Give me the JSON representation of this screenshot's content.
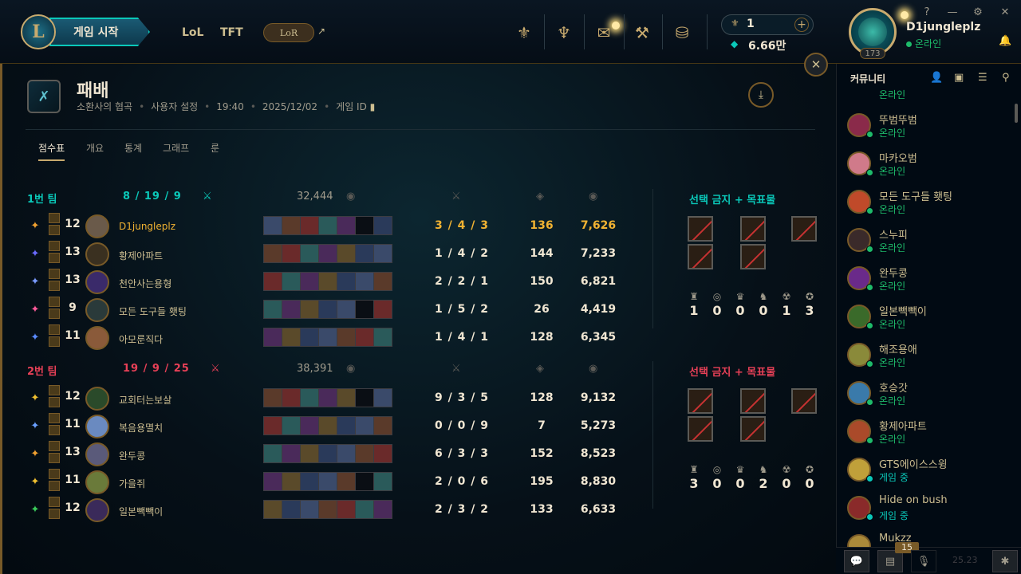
{
  "topbar": {
    "play_label": "게임 시작",
    "logo_glyph": "L",
    "nav_lol": "LoL",
    "nav_tft": "TFT",
    "nav_lor": "LoR",
    "external_glyph": "↗",
    "icons": {
      "ranked": "⚜",
      "collection": "♆",
      "loot": "✉",
      "crafting": "⚒",
      "store": "⛁"
    },
    "currency_tokens": "1",
    "currency_be": "6.66만",
    "plus_glyph": "+",
    "token_glyph": "⚜",
    "be_glyph": "◆",
    "username": "D1jungleplz",
    "status": "온라인",
    "level": "173",
    "window_help": "?",
    "window_min": "—",
    "window_settings": "⚙",
    "window_close": "✕",
    "bell_glyph": "🔔"
  },
  "match": {
    "result": "패배",
    "map": "소환사의 협곡",
    "mode": "사용자 설정",
    "duration": "19:40",
    "date": "2025/12/02",
    "game_id_label": "게임 ID",
    "close_glyph": "✕",
    "download_glyph": "⤓",
    "result_glyph": "✗",
    "tabs": [
      "점수표",
      "개요",
      "통계",
      "그래프",
      "룬"
    ]
  },
  "column_icons": {
    "kda": "⚔",
    "cs": "◈",
    "gold": "◉",
    "kill_participation": "⚔"
  },
  "teams": [
    {
      "name": "1번 팀",
      "kda": "8 / 19 / 9",
      "gold": "32,444",
      "color": "#0ac8b9",
      "bans_title": "선택 금지 + 목표물",
      "bans": [
        "ban",
        "ban",
        "ban",
        "ban",
        "ban"
      ],
      "objectives": [
        "1",
        "0",
        "0",
        "0",
        "1",
        "3"
      ],
      "players": [
        {
          "name": "D1jungleplz",
          "level": "12",
          "kda": "3 / 4 / 3",
          "cs": "136",
          "gold": "7,626",
          "champ_color": "#6a5a4a",
          "sum_color": "#f0a030",
          "me": true
        },
        {
          "name": "황제아파트",
          "level": "13",
          "kda": "1 / 4 / 2",
          "cs": "144",
          "gold": "7,233",
          "champ_color": "#3a3020",
          "sum_color": "#6a6aff",
          "me": false
        },
        {
          "name": "천안사는용형",
          "level": "13",
          "kda": "2 / 2 / 1",
          "cs": "150",
          "gold": "6,821",
          "champ_color": "#3a2a6a",
          "sum_color": "#7a9aff",
          "me": false
        },
        {
          "name": "모든 도구들 횃팅",
          "level": "9",
          "kda": "1 / 5 / 2",
          "cs": "26",
          "gold": "4,419",
          "champ_color": "#2a3a3a",
          "sum_color": "#ff5a9a",
          "me": false
        },
        {
          "name": "아모룬직다",
          "level": "11",
          "kda": "1 / 4 / 1",
          "cs": "128",
          "gold": "6,345",
          "champ_color": "#8a5a3a",
          "sum_color": "#5a8aff",
          "me": false
        }
      ]
    },
    {
      "name": "2번 팀",
      "kda": "19 / 9 / 25",
      "gold": "38,391",
      "color": "#e84057",
      "bans_title": "선택 금지 + 목표물",
      "bans": [
        "ban",
        "ban",
        "ban",
        "ban",
        "ban"
      ],
      "objectives": [
        "3",
        "0",
        "0",
        "2",
        "0",
        "0"
      ],
      "players": [
        {
          "name": "교회터는보살",
          "level": "12",
          "kda": "9 / 3 / 5",
          "cs": "128",
          "gold": "9,132",
          "champ_color": "#2a4a2a",
          "sum_color": "#f0c030",
          "me": false
        },
        {
          "name": "복음용멸치",
          "level": "11",
          "kda": "0 / 0 / 9",
          "cs": "7",
          "gold": "5,273",
          "champ_color": "#6a8ac0",
          "sum_color": "#6aa0ff",
          "me": false
        },
        {
          "name": "완두콩",
          "level": "13",
          "kda": "6 / 3 / 3",
          "cs": "152",
          "gold": "8,523",
          "champ_color": "#5a5a7a",
          "sum_color": "#f0a030",
          "me": false
        },
        {
          "name": "가을쥐",
          "level": "11",
          "kda": "2 / 0 / 6",
          "cs": "195",
          "gold": "8,830",
          "champ_color": "#6a7a3a",
          "sum_color": "#f0c030",
          "me": false
        },
        {
          "name": "일본빽빽이",
          "level": "12",
          "kda": "2 / 3 / 2",
          "cs": "133",
          "gold": "6,633",
          "champ_color": "#3a2a5a",
          "sum_color": "#3aca5a",
          "me": false
        }
      ]
    }
  ],
  "objective_icons": [
    "♜",
    "◎",
    "♛",
    "♞",
    "☢",
    "✪"
  ],
  "social": {
    "header": "커뮤니티",
    "icons": {
      "add_friend": "👤",
      "add_folder": "▣",
      "list": "☰",
      "search": "⚲"
    },
    "partial_status": "온라인",
    "friends": [
      {
        "name": "뚜범뚜범",
        "status": "온라인",
        "type": "online",
        "color": "#8a2a4a"
      },
      {
        "name": "마카오범",
        "status": "온라인",
        "type": "online",
        "color": "#d07a8a"
      },
      {
        "name": "모든 도구들 횃팅",
        "status": "온라인",
        "type": "online",
        "color": "#c04a2a"
      },
      {
        "name": "스누피",
        "status": "온라인",
        "type": "online",
        "color": "#3a2a2a"
      },
      {
        "name": "완두콩",
        "status": "온라인",
        "type": "online",
        "color": "#6a2a8a"
      },
      {
        "name": "일본빽빽이",
        "status": "온라인",
        "type": "online",
        "color": "#3a6a2a"
      },
      {
        "name": "해조용애",
        "status": "온라인",
        "type": "online",
        "color": "#8a8a3a"
      },
      {
        "name": "호승갓",
        "status": "온라인",
        "type": "online",
        "color": "#3a7aaa"
      },
      {
        "name": "황제아파트",
        "status": "온라인",
        "type": "online",
        "color": "#aa4a2a"
      },
      {
        "name": "GTS에이스스윙",
        "status": "게임 중",
        "type": "ingame",
        "color": "#c0a03a"
      },
      {
        "name": "Hide on bush",
        "status": "게임 중",
        "type": "ingame",
        "color": "#8a2a2a"
      },
      {
        "name": "Mukzz",
        "status": "",
        "type": "online",
        "color": "#aa8a3a"
      }
    ],
    "bottom_count": "15",
    "version": "25.23",
    "chat_glyph": "💬",
    "mission_glyph": "▤",
    "mic_glyph": "🎙",
    "bug_glyph": "✱"
  }
}
